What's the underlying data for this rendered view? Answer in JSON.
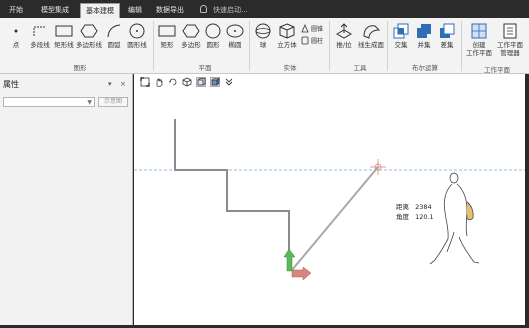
{
  "tabs": [
    {
      "label": "开始"
    },
    {
      "label": "模型集成"
    },
    {
      "label": "基本建模"
    },
    {
      "label": "编辑"
    },
    {
      "label": "数据导出"
    }
  ],
  "search_placeholder": "快速启动...",
  "ribbon": {
    "shapes": {
      "buttons": [
        "点",
        "多段线",
        "矩形线",
        "多边形线",
        "圆弧",
        "圆形线"
      ],
      "group": "图形"
    },
    "plane": {
      "buttons": [
        "矩形",
        "多边形",
        "圆形",
        "椭圆"
      ],
      "group": "平面"
    },
    "solid": {
      "buttons": [
        "球",
        "立方体"
      ],
      "small": [
        "圆锥",
        "圆柱"
      ],
      "group": "实体"
    },
    "tools": {
      "buttons": [
        "推/拉",
        "线生成面"
      ],
      "group": "工具"
    },
    "boolean": {
      "buttons": [
        "交集",
        "并集",
        "差集"
      ],
      "group": "布尔运算"
    },
    "workplane": {
      "buttons": [
        {
          "l1": "创建",
          "l2": "工作平面"
        },
        {
          "l1": "工作平面",
          "l2": "管理器"
        }
      ],
      "group": "工作平面"
    }
  },
  "properties": {
    "title": "属性",
    "pin": "▾",
    "close": "×",
    "select_value": "",
    "show_button": "示意图"
  },
  "measurement": {
    "distance_label": "距离",
    "distance_value": "2384",
    "angle_label": "角度",
    "angle_value": "120.1"
  },
  "colors": {
    "tab_bar": "#2b2b2b",
    "ribbon_bg": "#f3f3f3",
    "icon_blue": "#2e6fb3",
    "guide_line": "#6fa8dc",
    "shape_line": "#8c8c8c",
    "arrow_green": "#5cb85c",
    "arrow_red": "#d9857f"
  }
}
